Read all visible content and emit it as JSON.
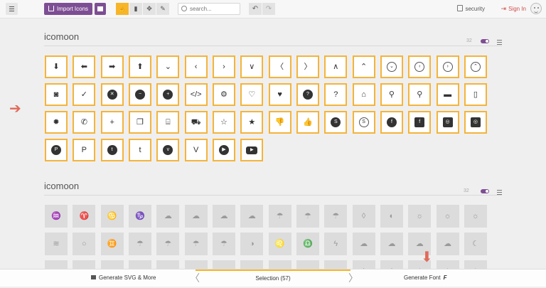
{
  "toolbar": {
    "import_label": "Import Icons",
    "search_placeholder": "search...",
    "security_label": "security",
    "signin_label": "Sign In",
    "accent": "#7e4e94",
    "highlight": "#f7b529"
  },
  "set1": {
    "title": "icomoon",
    "count": "32",
    "glyphs": [
      {
        "icon": "arrow-down-icon",
        "ch": "⬇",
        "s": ""
      },
      {
        "icon": "arrow-left-icon",
        "ch": "⬅",
        "s": ""
      },
      {
        "icon": "arrow-right-icon",
        "ch": "➡",
        "s": ""
      },
      {
        "icon": "arrow-up-icon",
        "ch": "⬆",
        "s": ""
      },
      {
        "icon": "chevron-down-icon",
        "ch": "⌄",
        "s": ""
      },
      {
        "icon": "chevron-left-icon",
        "ch": "‹",
        "s": ""
      },
      {
        "icon": "chevron-right-icon",
        "ch": "›",
        "s": ""
      },
      {
        "icon": "chevron-thin-down-icon",
        "ch": "∨",
        "s": ""
      },
      {
        "icon": "chevron-thin-left-icon",
        "ch": "〈",
        "s": ""
      },
      {
        "icon": "chevron-thin-right-icon",
        "ch": "〉",
        "s": ""
      },
      {
        "icon": "chevron-thin-up-icon",
        "ch": "∧",
        "s": ""
      },
      {
        "icon": "chevron-up-icon",
        "ch": "⌃",
        "s": ""
      },
      {
        "icon": "circle-chevron-down-icon",
        "ch": "⌄",
        "s": "b-circle"
      },
      {
        "icon": "circle-chevron-left-icon",
        "ch": "‹",
        "s": "b-circle"
      },
      {
        "icon": "circle-chevron-right-icon",
        "ch": "›",
        "s": "b-circle"
      },
      {
        "icon": "circle-chevron-up-icon",
        "ch": "⌃",
        "s": "b-circle"
      },
      {
        "icon": "camera-icon",
        "ch": "◙",
        "s": ""
      },
      {
        "icon": "checkmark-icon",
        "ch": "✓",
        "s": ""
      },
      {
        "icon": "circle-close-icon",
        "ch": "✕",
        "s": "f-circle"
      },
      {
        "icon": "circle-minus-icon",
        "ch": "−",
        "s": "f-circle"
      },
      {
        "icon": "circle-plus-icon",
        "ch": "+",
        "s": "f-circle"
      },
      {
        "icon": "code-icon",
        "ch": "</>",
        "s": ""
      },
      {
        "icon": "cog-icon",
        "ch": "⚙",
        "s": ""
      },
      {
        "icon": "heart-outline-icon",
        "ch": "♡",
        "s": ""
      },
      {
        "icon": "heart-icon",
        "ch": "♥",
        "s": ""
      },
      {
        "icon": "circle-question-icon",
        "ch": "?",
        "s": "f-circle"
      },
      {
        "icon": "question-icon",
        "ch": "?",
        "s": ""
      },
      {
        "icon": "home-icon",
        "ch": "⌂",
        "s": ""
      },
      {
        "icon": "location-icon",
        "ch": "⚲",
        "s": ""
      },
      {
        "icon": "search-icon",
        "ch": "⚲",
        "s": ""
      },
      {
        "icon": "comment-icon",
        "ch": "▬",
        "s": ""
      },
      {
        "icon": "mobile-icon",
        "ch": "▯",
        "s": ""
      },
      {
        "icon": "badge-icon",
        "ch": "✹",
        "s": ""
      },
      {
        "icon": "phone-icon",
        "ch": "✆",
        "s": ""
      },
      {
        "icon": "plus-icon",
        "ch": "+",
        "s": ""
      },
      {
        "icon": "copy-icon",
        "ch": "❐",
        "s": ""
      },
      {
        "icon": "store-icon",
        "ch": "⌸",
        "s": ""
      },
      {
        "icon": "cart-icon",
        "ch": "⛟",
        "s": ""
      },
      {
        "icon": "star-outline-icon",
        "ch": "☆",
        "s": ""
      },
      {
        "icon": "star-icon",
        "ch": "★",
        "s": ""
      },
      {
        "icon": "thumbs-down-icon",
        "ch": "👎",
        "s": ""
      },
      {
        "icon": "thumbs-up-icon",
        "ch": "👍",
        "s": ""
      },
      {
        "icon": "skype-circle-icon",
        "ch": "S",
        "s": "f-circle"
      },
      {
        "icon": "skype-icon",
        "ch": "S",
        "s": "b-circle"
      },
      {
        "icon": "facebook-circle-icon",
        "ch": "f",
        "s": "f-circle"
      },
      {
        "icon": "facebook-square-icon",
        "ch": "f",
        "s": "f-square"
      },
      {
        "icon": "instagram-square-icon",
        "ch": "◎",
        "s": "f-square"
      },
      {
        "icon": "instagram-icon",
        "ch": "◎",
        "s": "f-square"
      },
      {
        "icon": "pinterest-circle-icon",
        "ch": "P",
        "s": "f-circle"
      },
      {
        "icon": "pinterest-icon",
        "ch": "P",
        "s": ""
      },
      {
        "icon": "twitter-circle-icon",
        "ch": "t",
        "s": "f-circle"
      },
      {
        "icon": "twitter-icon",
        "ch": "t",
        "s": ""
      },
      {
        "icon": "vimeo-circle-icon",
        "ch": "v",
        "s": "f-circle"
      },
      {
        "icon": "vimeo-icon",
        "ch": "V",
        "s": ""
      },
      {
        "icon": "youtube-circle-icon",
        "ch": "▶",
        "s": "f-circle"
      },
      {
        "icon": "youtube-icon",
        "ch": "▶",
        "s": "f-rect"
      }
    ]
  },
  "set2": {
    "title": "icomoon",
    "count": "32",
    "glyphs": [
      {
        "icon": "aquarius-icon",
        "ch": "♒",
        "s": ""
      },
      {
        "icon": "aries-icon",
        "ch": "♈",
        "s": ""
      },
      {
        "icon": "cancer-icon",
        "ch": "♋",
        "s": ""
      },
      {
        "icon": "capricorn-icon",
        "ch": "♑",
        "s": ""
      },
      {
        "icon": "cloud-download-icon",
        "ch": "☁",
        "s": ""
      },
      {
        "icon": "cloud-lightning-icon",
        "ch": "☁",
        "s": ""
      },
      {
        "icon": "cloud-upload-icon",
        "ch": "☁",
        "s": ""
      },
      {
        "icon": "cloud-icon",
        "ch": "☁",
        "s": ""
      },
      {
        "icon": "cloud-rain-icon",
        "ch": "☂",
        "s": ""
      },
      {
        "icon": "cloud-sun-rain-icon",
        "ch": "☂",
        "s": ""
      },
      {
        "icon": "cloud-drizzle-icon",
        "ch": "☂",
        "s": ""
      },
      {
        "icon": "drop-icon",
        "ch": "◊",
        "s": ""
      },
      {
        "icon": "half-circle-icon",
        "ch": "◐",
        "s": ""
      },
      {
        "icon": "sun-cloud-icon",
        "ch": "☼",
        "s": ""
      },
      {
        "icon": "sun-cloud-alt-icon",
        "ch": "☼",
        "s": ""
      },
      {
        "icon": "sun-cloud-rain-icon",
        "ch": "☼",
        "s": ""
      },
      {
        "icon": "fog-icon",
        "ch": "≋",
        "s": ""
      },
      {
        "icon": "circle-outline-icon",
        "ch": "○",
        "s": ""
      },
      {
        "icon": "gemini-icon",
        "ch": "♊",
        "s": ""
      },
      {
        "icon": "cloud-heavy-rain-icon",
        "ch": "☂",
        "s": ""
      },
      {
        "icon": "cloud-rain-alt-icon",
        "ch": "☂",
        "s": ""
      },
      {
        "icon": "cloud-showers-icon",
        "ch": "☂",
        "s": ""
      },
      {
        "icon": "cloud-storm-icon",
        "ch": "☂",
        "s": ""
      },
      {
        "icon": "half-moon-circle-icon",
        "ch": "◑",
        "s": ""
      },
      {
        "icon": "leo-icon",
        "ch": "♌",
        "s": ""
      },
      {
        "icon": "libra-icon",
        "ch": "♎",
        "s": ""
      },
      {
        "icon": "lightning-icon",
        "ch": "ϟ",
        "s": ""
      },
      {
        "icon": "moon-cloud-icon",
        "ch": "☁",
        "s": ""
      },
      {
        "icon": "moon-cloud-alt-icon",
        "ch": "☁",
        "s": ""
      },
      {
        "icon": "moon-cloud-rain-icon",
        "ch": "☁",
        "s": ""
      },
      {
        "icon": "moon-fog-icon",
        "ch": "☁",
        "s": ""
      },
      {
        "icon": "moon-icon",
        "ch": "☾",
        "s": ""
      },
      {
        "icon": "cloud-partial-icon",
        "ch": "☁",
        "s": ""
      },
      {
        "icon": "cloud-partial-alt-icon",
        "ch": "☁",
        "s": ""
      },
      {
        "icon": "cloud-partial-rain-icon",
        "ch": "☁",
        "s": ""
      },
      {
        "icon": "cloud-partial-storm-icon",
        "ch": "☁",
        "s": ""
      },
      {
        "icon": "sun-half-icon",
        "ch": "◒",
        "s": ""
      },
      {
        "icon": "sun-partial-icon",
        "ch": "☼",
        "s": ""
      },
      {
        "icon": "sun-partial-alt-icon",
        "ch": "☼",
        "s": ""
      },
      {
        "icon": "sun-partial-rain-icon",
        "ch": "☼",
        "s": ""
      },
      {
        "icon": "sun-partial-storm-icon",
        "ch": "☼",
        "s": ""
      },
      {
        "icon": "sun-partial-fog-icon",
        "ch": "☼",
        "s": ""
      },
      {
        "icon": "wind-icon",
        "ch": "≈",
        "s": ""
      },
      {
        "icon": "snow-icon",
        "ch": "❄",
        "s": ""
      },
      {
        "icon": "snowflake-icon",
        "ch": "❄",
        "s": ""
      },
      {
        "icon": "sun-set-icon",
        "ch": "☀",
        "s": ""
      },
      {
        "icon": "sun-rise-icon",
        "ch": "☀",
        "s": ""
      },
      {
        "icon": "sun-small-icon",
        "ch": "☀",
        "s": ""
      }
    ]
  },
  "bottombar": {
    "generate_svg_label": "Generate SVG & More",
    "selection_label": "Selection (57)",
    "generate_font_label": "Generate Font"
  }
}
